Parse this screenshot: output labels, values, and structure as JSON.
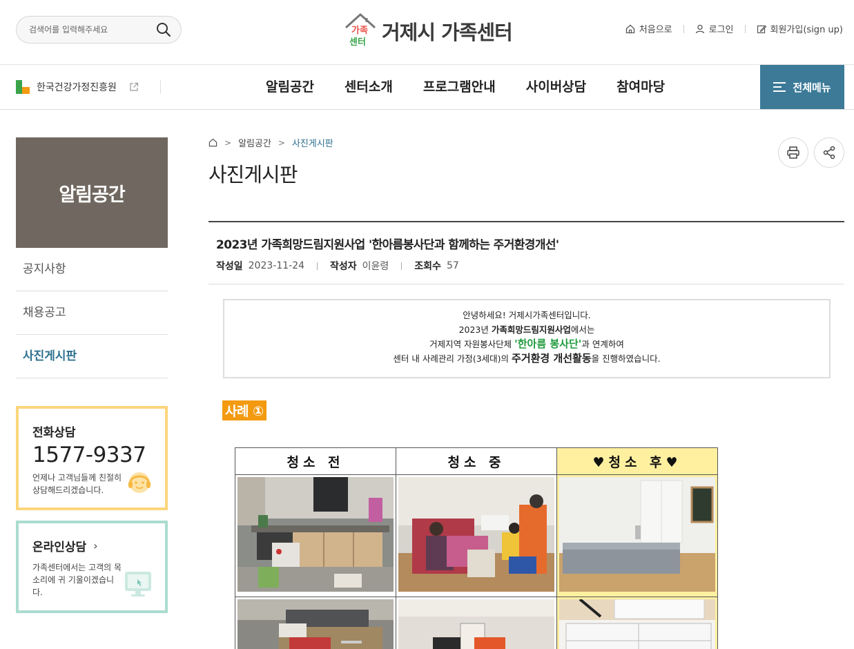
{
  "header": {
    "search_placeholder": "검색어를 입력해주세요",
    "logo_mark_top": "가족",
    "logo_mark_bottom": "센터",
    "logo_title": "거제시 가족센터",
    "util": {
      "home": "처음으로",
      "login": "로그인",
      "signup": "회원가입(sign up)"
    }
  },
  "gnb": {
    "kihf_label": "한국건강가정진흥원",
    "menu": [
      "알림공간",
      "센터소개",
      "프로그램안내",
      "사이버상담",
      "참여마당"
    ],
    "all_menu": "전체메뉴"
  },
  "sidebar": {
    "title": "알림공간",
    "items": [
      "공지사항",
      "채용공고",
      "사진게시판"
    ],
    "call": {
      "title": "전화상담",
      "number": "1577-9337",
      "desc": "언제나 고객님들께 친절히 상담해드리겠습니다."
    },
    "online": {
      "title": "온라인상담",
      "chevron": "›",
      "desc": "가족센터에서는 고객의 목소리에 귀 기울이겠습니다."
    }
  },
  "content": {
    "breadcrumb": [
      "알림공간",
      "사진게시판"
    ],
    "page_title": "사진게시판",
    "post": {
      "title": "2023년 가족희망드림지원사업 '한아름봉사단과 함께하는 주거환경개선'",
      "date_label": "작성일",
      "date": "2023-11-24",
      "author_label": "작성자",
      "author": "이윤령",
      "views_label": "조회수",
      "views": "57"
    },
    "intro": {
      "line1": "안녕하세요! 거제시가족센터입니다.",
      "line2_pre": "2023년 ",
      "line2_bold": "가족희망드림지원사업",
      "line2_post": "에서는",
      "line3_pre": "거제지역 자원봉사단체 ",
      "line3_hl": "'한아름 봉사단'",
      "line3_post": "과 연계하여",
      "line4_pre": "센터 내 사례관리 가정(3세대)의 ",
      "line4_big": "주거환경 개선활동",
      "line4_post": "을 진행하였습니다."
    },
    "case_label": "사례 ①",
    "photo_headers": [
      "청소 전",
      "청소 중",
      "♥청소 후♥"
    ]
  },
  "colors": {
    "accent": "#3c7a98",
    "sidebar_title_bg": "#706860",
    "call_border": "#fcd57c",
    "online_border": "#a9dccf",
    "case_label_bg": "#f39a10",
    "after_header_bg": "#fff0a0"
  }
}
